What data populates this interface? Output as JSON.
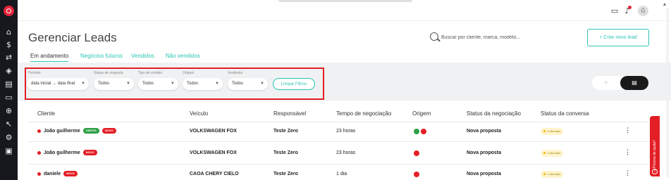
{
  "sidebar": {
    "icons": [
      "home-icon",
      "dollar-icon",
      "transfer-icon",
      "car-icon",
      "cart-icon",
      "card-icon",
      "target-icon",
      "pointer-icon",
      "settings-icon",
      "document-icon"
    ]
  },
  "topbar": {
    "icons": [
      "message-icon",
      "bell-icon"
    ],
    "avatar": "G"
  },
  "header": {
    "title": "Gerenciar Leads",
    "search_placeholder": "Buscar por cliente, marca, modelo...",
    "new_lead_label": "+ Criar novo lead"
  },
  "tabs": [
    {
      "label": "Em andamento",
      "active": true
    },
    {
      "label": "Negócios futuros",
      "active": false
    },
    {
      "label": "Vendidos",
      "active": false
    },
    {
      "label": "Não vendidos",
      "active": false
    }
  ],
  "filters": {
    "periodo": {
      "label": "Período",
      "value": "data inicial → data final"
    },
    "status_resposta": {
      "label": "Status de resposta",
      "value": "Todos"
    },
    "tipo_contato": {
      "label": "Tipo de contato",
      "value": "Todos"
    },
    "origem": {
      "label": "Origem",
      "value": "Todos"
    },
    "vendedor": {
      "label": "Vendedor",
      "value": "Todos"
    },
    "clear_label": "Limpar Filtros"
  },
  "table": {
    "headers": [
      "Cliente",
      "Veículo",
      "Responsável",
      "Tempo de negociação",
      "Origem",
      "Status da negociação",
      "Status da conversa"
    ],
    "rows": [
      {
        "cliente": "João guilherme",
        "badges": [
          "GRÁTIS",
          "NOVO"
        ],
        "veiculo": "VOLKSWAGEN FOX",
        "responsavel": "Teste Zero",
        "tempo": "23 horas",
        "origem": [
          "whatsapp",
          "red"
        ],
        "status_negociacao": "Nova proposta",
        "status_conversa": "1 não lidas"
      },
      {
        "cliente": "João guilherme",
        "badges": [
          "NOVO"
        ],
        "veiculo": "VOLKSWAGEN FOX",
        "responsavel": "Teste Zero",
        "tempo": "23 horas",
        "origem": [
          "red"
        ],
        "status_negociacao": "Nova proposta",
        "status_conversa": "1 não lidas"
      },
      {
        "cliente": "daniele",
        "badges": [
          "NOVO"
        ],
        "veiculo": "CAOA CHERY CIELO",
        "responsavel": "Teste Zero",
        "tempo": "1 dia",
        "origem": [
          "red"
        ],
        "status_negociacao": "Nova proposta",
        "status_conversa": "1 não lidas"
      }
    ]
  },
  "help": {
    "label": "Precisa de ajuda?"
  },
  "colors": {
    "accent": "#2ec4b6",
    "brand_red": "#e31e24",
    "sidebar": "#16181d"
  }
}
